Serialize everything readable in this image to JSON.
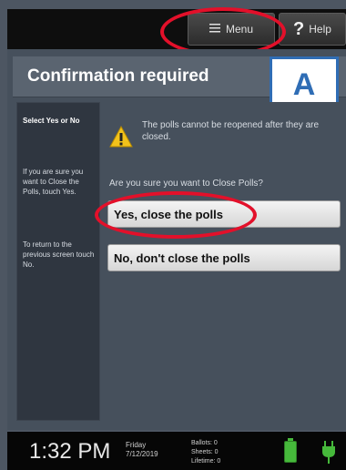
{
  "header": {
    "menu_label": "Menu",
    "help_label": "Help"
  },
  "dialog": {
    "title": "Confirmation required",
    "badge": "A",
    "sidebar": {
      "heading": "Select Yes or No",
      "text1": "If you are sure you want to Close the Polls, touch Yes.",
      "text2": "To return to the previous screen touch No."
    },
    "warning": "The polls cannot be reopened after they are closed.",
    "question": "Are you sure you want to Close Polls?",
    "yes_label": "Yes, close the polls",
    "no_label": "No, don't close the polls"
  },
  "status": {
    "time": "1:32 PM",
    "day": "Friday",
    "date": "7/12/2019",
    "ballots": "Ballots:   0",
    "sheets": "Sheets:   0",
    "lifetime": "Lifetime:  0"
  },
  "colors": {
    "annotation_red": "#e3102a",
    "badge_blue": "#2f6db5",
    "battery_green": "#46b93b"
  },
  "icons": [
    "menu-icon",
    "help-icon",
    "warning-icon",
    "battery-icon",
    "power-plug-icon"
  ]
}
